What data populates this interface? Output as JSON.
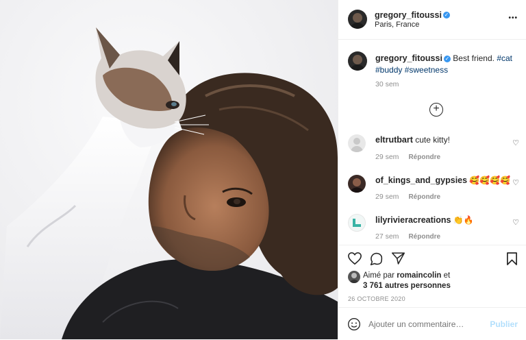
{
  "post": {
    "author": "gregory_fitoussi",
    "location": "Paris, France",
    "more_icon": "•••",
    "caption_text": "Best friend.",
    "hashtags_line1": "#cat",
    "hashtags_line2": "#buddy #sweetness",
    "caption_time": "30 sem",
    "load_more_icon": "⊕"
  },
  "comments": [
    {
      "user": "eltrutbart",
      "text": "cute kitty!",
      "time": "29 sem",
      "reply": "Répondre"
    },
    {
      "user": "of_kings_and_gypsies",
      "text": "🥰🥰🥰🥰",
      "time": "29 sem",
      "reply": "Répondre"
    },
    {
      "user": "lilyrivieracreations",
      "text": "👏🔥",
      "time": "27 sem",
      "reply": "Répondre"
    }
  ],
  "likes": {
    "prefix": "Aimé par",
    "user": "romaincolin",
    "suffix": "et",
    "others": "3 761 autres personnes"
  },
  "date": "26 OCTOBRE 2020",
  "add_comment": {
    "placeholder": "Ajouter un commentaire…",
    "publish": "Publier"
  }
}
